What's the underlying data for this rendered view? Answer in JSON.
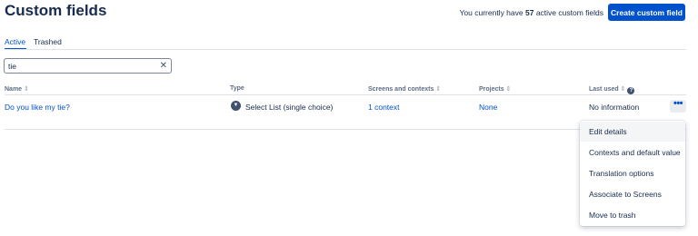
{
  "header": {
    "title": "Custom fields",
    "count_prefix": "You currently have",
    "count_value": "57",
    "count_suffix": "active custom fields",
    "create_button": "Create custom field"
  },
  "tabs": [
    {
      "label": "Active",
      "active": true
    },
    {
      "label": "Trashed",
      "active": false
    }
  ],
  "search": {
    "value": "tie",
    "clear_icon": "close-icon"
  },
  "table": {
    "columns": [
      {
        "label": "Name",
        "sortable": true
      },
      {
        "label": "Type",
        "sortable": false
      },
      {
        "label": "Screens and contexts",
        "sortable": true
      },
      {
        "label": "Projects",
        "sortable": true
      },
      {
        "label": "Last used",
        "sortable": true,
        "help": true
      }
    ],
    "rows": [
      {
        "name": "Do you like my tie?",
        "type": "Select List (single choice)",
        "type_icon": "chevron-down-icon",
        "screens": "1 context",
        "projects": "None",
        "last_used": "No information"
      }
    ]
  },
  "menu": {
    "items": [
      {
        "label": "Edit details",
        "highlighted": true
      },
      {
        "label": "Contexts and default value"
      },
      {
        "label": "Translation options"
      },
      {
        "label": "Associate to Screens"
      },
      {
        "label": "Move to trash"
      }
    ]
  },
  "colors": {
    "accent": "#0052cc",
    "text": "#172b4d",
    "subtle": "#5e6c84",
    "border": "#dfe1e6"
  }
}
